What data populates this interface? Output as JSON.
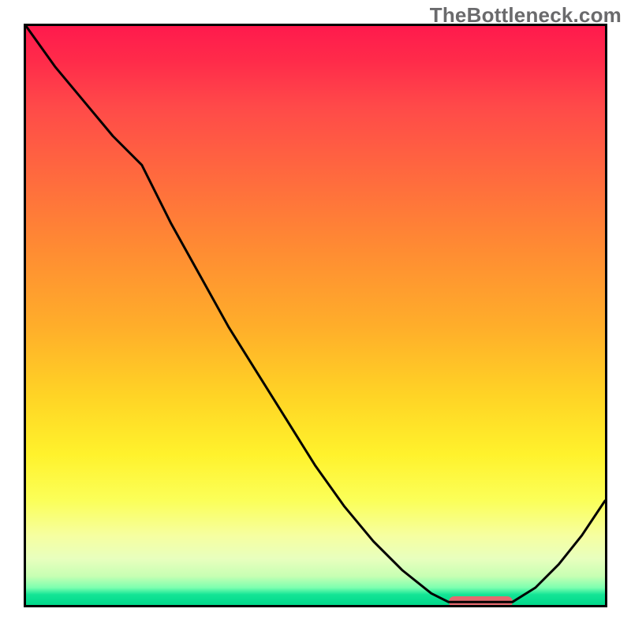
{
  "watermark": "TheBottleneck.com",
  "colors": {
    "frame": "#000000",
    "curve": "#000000",
    "marker": "#e46a6f",
    "gradient_top": "#ff1a4d",
    "gradient_mid": "#ffd425",
    "gradient_bottom": "#00d88a"
  },
  "chart_data": {
    "type": "line",
    "title": "",
    "xlabel": "",
    "ylabel": "",
    "xlim": [
      0,
      1
    ],
    "ylim": [
      0,
      1
    ],
    "series": [
      {
        "name": "curve",
        "x": [
          0.0,
          0.05,
          0.1,
          0.15,
          0.2,
          0.25,
          0.3,
          0.35,
          0.4,
          0.45,
          0.5,
          0.55,
          0.6,
          0.65,
          0.7,
          0.73,
          0.78,
          0.84,
          0.88,
          0.92,
          0.96,
          1.0
        ],
        "y": [
          1.0,
          0.93,
          0.87,
          0.81,
          0.76,
          0.66,
          0.57,
          0.48,
          0.4,
          0.32,
          0.24,
          0.17,
          0.11,
          0.06,
          0.02,
          0.005,
          0.005,
          0.005,
          0.03,
          0.07,
          0.12,
          0.18
        ]
      }
    ],
    "marker_segment": {
      "x_start": 0.73,
      "x_end": 0.84,
      "y": 0.005
    },
    "grid": false,
    "legend": false
  }
}
